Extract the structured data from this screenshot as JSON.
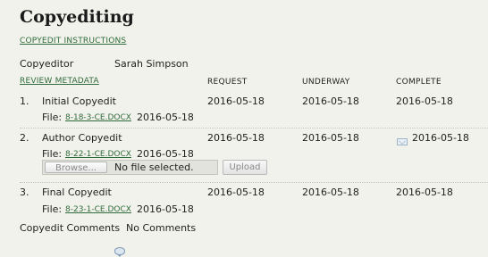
{
  "page": {
    "title": "Copyediting",
    "instructions_link": "COPYEDIT INSTRUCTIONS",
    "copyeditor_label": "Copyeditor",
    "copyeditor_name": "Sarah Simpson",
    "review_metadata_link": "REVIEW METADATA"
  },
  "columns": {
    "request": "REQUEST",
    "underway": "UNDERWAY",
    "complete": "COMPLETE"
  },
  "steps": [
    {
      "number": "1.",
      "name": "Initial Copyedit",
      "request": "2016-05-18",
      "underway": "2016-05-18",
      "complete": "2016-05-18",
      "file_label": "File:",
      "file_name": "8-18-3-CE.DOCX",
      "file_date": "2016-05-18"
    },
    {
      "number": "2.",
      "name": "Author Copyedit",
      "request": "2016-05-18",
      "underway": "2016-05-18",
      "complete": "2016-05-18",
      "complete_icon": "email-icon",
      "file_label": "File:",
      "file_name": "8-22-1-CE.DOCX",
      "file_date": "2016-05-18"
    },
    {
      "number": "3.",
      "name": "Final Copyedit",
      "request": "2016-05-18",
      "underway": "2016-05-18",
      "complete": "2016-05-18",
      "file_label": "File:",
      "file_name": "8-23-1-CE.DOCX",
      "file_date": "2016-05-18"
    }
  ],
  "upload": {
    "browse_label": "Browse...",
    "no_file_text": "No file selected.",
    "upload_label": "Upload"
  },
  "comments": {
    "label": "Copyedit Comments",
    "icon": "comment-icon",
    "value": "No Comments"
  }
}
